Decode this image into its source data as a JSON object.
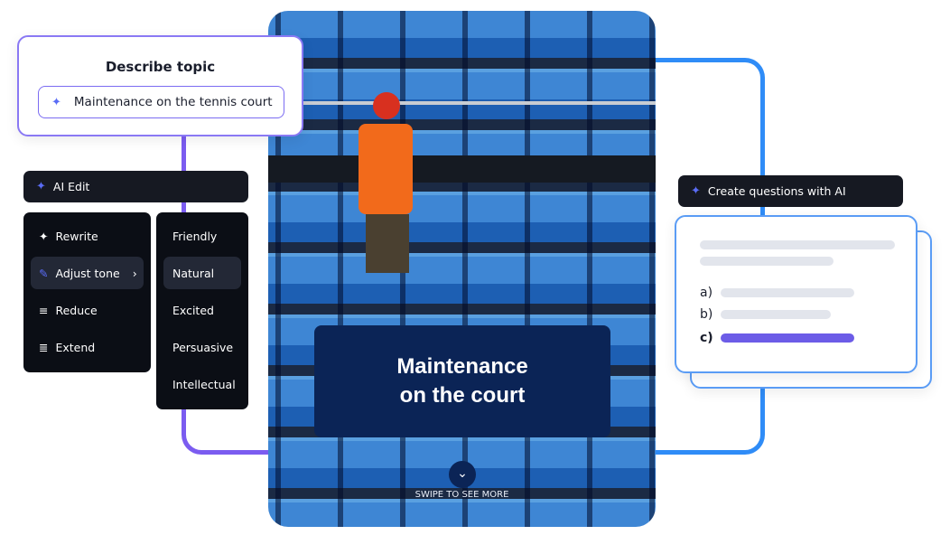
{
  "describe": {
    "title": "Describe topic",
    "input_value": "Maintenance on the tennis court"
  },
  "ai_edit": {
    "label": "AI Edit",
    "menu": [
      {
        "label": "Rewrite",
        "icon": "sparkle-icon"
      },
      {
        "label": "Adjust tone",
        "icon": "pen-icon",
        "selected": true
      },
      {
        "label": "Reduce",
        "icon": "lines-short-icon"
      },
      {
        "label": "Extend",
        "icon": "lines-long-icon"
      }
    ],
    "tones": [
      "Friendly",
      "Natural",
      "Excited",
      "Persuasive",
      "Intellectual"
    ],
    "selected_tone": "Natural"
  },
  "card": {
    "title_line1": "Maintenance",
    "title_line2": "on the court",
    "swipe": "SWIPE TO SEE MORE"
  },
  "questions": {
    "label": "Create questions with AI",
    "options": [
      "a)",
      "b)",
      "c)"
    ],
    "selected": "c)",
    "accent": "#6c5ce7"
  }
}
